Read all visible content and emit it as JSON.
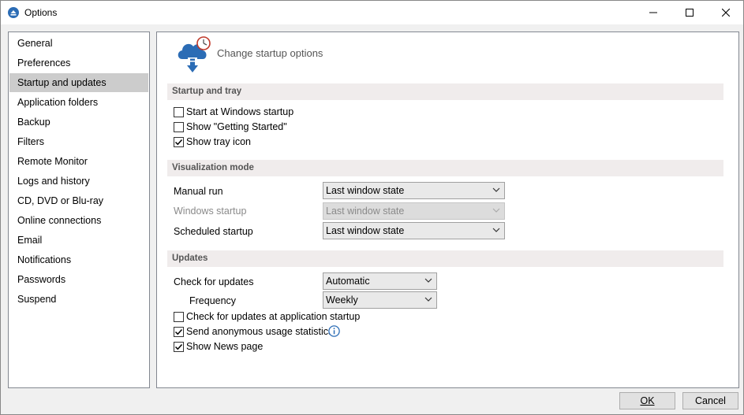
{
  "window": {
    "title": "Options"
  },
  "sidebar": {
    "items": [
      {
        "label": "General"
      },
      {
        "label": "Preferences"
      },
      {
        "label": "Startup and updates",
        "selected": true
      },
      {
        "label": "Application folders"
      },
      {
        "label": "Backup"
      },
      {
        "label": "Filters"
      },
      {
        "label": "Remote Monitor"
      },
      {
        "label": "Logs and history"
      },
      {
        "label": "CD, DVD or Blu-ray"
      },
      {
        "label": "Online connections"
      },
      {
        "label": "Email"
      },
      {
        "label": "Notifications"
      },
      {
        "label": "Passwords"
      },
      {
        "label": "Suspend"
      }
    ]
  },
  "page": {
    "title": "Change startup options",
    "icon": "cloud-download-clock-icon"
  },
  "startup_tray": {
    "heading": "Startup and tray",
    "start_windows": {
      "label": "Start at Windows startup",
      "checked": false
    },
    "getting_started": {
      "label": "Show \"Getting Started\"",
      "checked": false
    },
    "tray_icon": {
      "label": "Show tray icon",
      "checked": true
    }
  },
  "visualization": {
    "heading": "Visualization mode",
    "manual_run": {
      "label": "Manual run",
      "value": "Last window state"
    },
    "windows_startup": {
      "label": "Windows startup",
      "value": "Last window state",
      "disabled": true
    },
    "scheduled_startup": {
      "label": "Scheduled startup",
      "value": "Last window state"
    }
  },
  "updates": {
    "heading": "Updates",
    "check_for_updates": {
      "label": "Check for updates",
      "value": "Automatic"
    },
    "frequency": {
      "label": "Frequency",
      "value": "Weekly"
    },
    "check_at_startup": {
      "label": "Check for updates at application startup",
      "checked": false
    },
    "anonymous_stats": {
      "label": "Send anonymous usage statistics",
      "checked": true
    },
    "news_page": {
      "label": "Show News page",
      "checked": true
    }
  },
  "buttons": {
    "ok": "OK",
    "cancel": "Cancel"
  },
  "colors": {
    "accent": "#2b6cb5",
    "selected_bg": "#cccccc",
    "section_bg": "#f0ecec",
    "clock_red": "#c0392b"
  }
}
